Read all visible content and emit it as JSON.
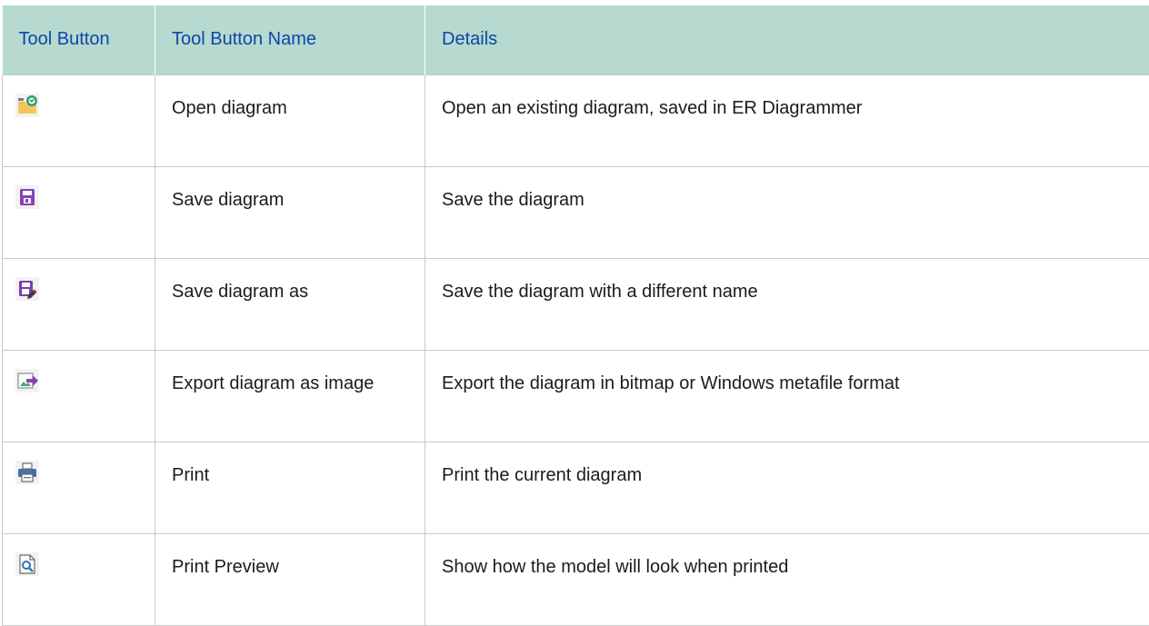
{
  "table": {
    "headers": [
      "Tool Button",
      "Tool Button Name",
      "Details"
    ],
    "rows": [
      {
        "icon": "open-folder-icon",
        "name": "Open diagram",
        "details": "Open an existing diagram, saved in ER Diagrammer"
      },
      {
        "icon": "save-disk-icon",
        "name": "Save diagram",
        "details": "Save the diagram"
      },
      {
        "icon": "save-as-disk-icon",
        "name": "Save diagram as",
        "details": "Save the diagram with a different name"
      },
      {
        "icon": "export-image-icon",
        "name": "Export diagram as image",
        "details": "Export the diagram in bitmap or Windows metafile format"
      },
      {
        "icon": "printer-icon",
        "name": "Print",
        "details": "Print the current diagram"
      },
      {
        "icon": "print-preview-icon",
        "name": "Print Preview",
        "details": "Show how the model will look when printed"
      }
    ]
  },
  "colors": {
    "header_bg": "#b6d9d0",
    "header_text": "#0d47a6",
    "border": "#c9c9c9"
  }
}
